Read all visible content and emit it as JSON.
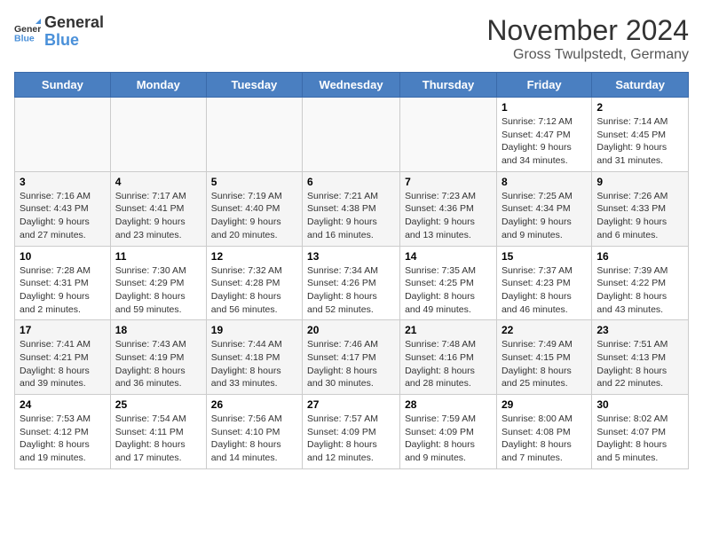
{
  "header": {
    "logo_line1": "General",
    "logo_line2": "Blue",
    "month": "November 2024",
    "location": "Gross Twulpstedt, Germany"
  },
  "weekdays": [
    "Sunday",
    "Monday",
    "Tuesday",
    "Wednesday",
    "Thursday",
    "Friday",
    "Saturday"
  ],
  "weeks": [
    [
      {
        "day": "",
        "info": ""
      },
      {
        "day": "",
        "info": ""
      },
      {
        "day": "",
        "info": ""
      },
      {
        "day": "",
        "info": ""
      },
      {
        "day": "",
        "info": ""
      },
      {
        "day": "1",
        "info": "Sunrise: 7:12 AM\nSunset: 4:47 PM\nDaylight: 9 hours and 34 minutes."
      },
      {
        "day": "2",
        "info": "Sunrise: 7:14 AM\nSunset: 4:45 PM\nDaylight: 9 hours and 31 minutes."
      }
    ],
    [
      {
        "day": "3",
        "info": "Sunrise: 7:16 AM\nSunset: 4:43 PM\nDaylight: 9 hours and 27 minutes."
      },
      {
        "day": "4",
        "info": "Sunrise: 7:17 AM\nSunset: 4:41 PM\nDaylight: 9 hours and 23 minutes."
      },
      {
        "day": "5",
        "info": "Sunrise: 7:19 AM\nSunset: 4:40 PM\nDaylight: 9 hours and 20 minutes."
      },
      {
        "day": "6",
        "info": "Sunrise: 7:21 AM\nSunset: 4:38 PM\nDaylight: 9 hours and 16 minutes."
      },
      {
        "day": "7",
        "info": "Sunrise: 7:23 AM\nSunset: 4:36 PM\nDaylight: 9 hours and 13 minutes."
      },
      {
        "day": "8",
        "info": "Sunrise: 7:25 AM\nSunset: 4:34 PM\nDaylight: 9 hours and 9 minutes."
      },
      {
        "day": "9",
        "info": "Sunrise: 7:26 AM\nSunset: 4:33 PM\nDaylight: 9 hours and 6 minutes."
      }
    ],
    [
      {
        "day": "10",
        "info": "Sunrise: 7:28 AM\nSunset: 4:31 PM\nDaylight: 9 hours and 2 minutes."
      },
      {
        "day": "11",
        "info": "Sunrise: 7:30 AM\nSunset: 4:29 PM\nDaylight: 8 hours and 59 minutes."
      },
      {
        "day": "12",
        "info": "Sunrise: 7:32 AM\nSunset: 4:28 PM\nDaylight: 8 hours and 56 minutes."
      },
      {
        "day": "13",
        "info": "Sunrise: 7:34 AM\nSunset: 4:26 PM\nDaylight: 8 hours and 52 minutes."
      },
      {
        "day": "14",
        "info": "Sunrise: 7:35 AM\nSunset: 4:25 PM\nDaylight: 8 hours and 49 minutes."
      },
      {
        "day": "15",
        "info": "Sunrise: 7:37 AM\nSunset: 4:23 PM\nDaylight: 8 hours and 46 minutes."
      },
      {
        "day": "16",
        "info": "Sunrise: 7:39 AM\nSunset: 4:22 PM\nDaylight: 8 hours and 43 minutes."
      }
    ],
    [
      {
        "day": "17",
        "info": "Sunrise: 7:41 AM\nSunset: 4:21 PM\nDaylight: 8 hours and 39 minutes."
      },
      {
        "day": "18",
        "info": "Sunrise: 7:43 AM\nSunset: 4:19 PM\nDaylight: 8 hours and 36 minutes."
      },
      {
        "day": "19",
        "info": "Sunrise: 7:44 AM\nSunset: 4:18 PM\nDaylight: 8 hours and 33 minutes."
      },
      {
        "day": "20",
        "info": "Sunrise: 7:46 AM\nSunset: 4:17 PM\nDaylight: 8 hours and 30 minutes."
      },
      {
        "day": "21",
        "info": "Sunrise: 7:48 AM\nSunset: 4:16 PM\nDaylight: 8 hours and 28 minutes."
      },
      {
        "day": "22",
        "info": "Sunrise: 7:49 AM\nSunset: 4:15 PM\nDaylight: 8 hours and 25 minutes."
      },
      {
        "day": "23",
        "info": "Sunrise: 7:51 AM\nSunset: 4:13 PM\nDaylight: 8 hours and 22 minutes."
      }
    ],
    [
      {
        "day": "24",
        "info": "Sunrise: 7:53 AM\nSunset: 4:12 PM\nDaylight: 8 hours and 19 minutes."
      },
      {
        "day": "25",
        "info": "Sunrise: 7:54 AM\nSunset: 4:11 PM\nDaylight: 8 hours and 17 minutes."
      },
      {
        "day": "26",
        "info": "Sunrise: 7:56 AM\nSunset: 4:10 PM\nDaylight: 8 hours and 14 minutes."
      },
      {
        "day": "27",
        "info": "Sunrise: 7:57 AM\nSunset: 4:09 PM\nDaylight: 8 hours and 12 minutes."
      },
      {
        "day": "28",
        "info": "Sunrise: 7:59 AM\nSunset: 4:09 PM\nDaylight: 8 hours and 9 minutes."
      },
      {
        "day": "29",
        "info": "Sunrise: 8:00 AM\nSunset: 4:08 PM\nDaylight: 8 hours and 7 minutes."
      },
      {
        "day": "30",
        "info": "Sunrise: 8:02 AM\nSunset: 4:07 PM\nDaylight: 8 hours and 5 minutes."
      }
    ]
  ]
}
